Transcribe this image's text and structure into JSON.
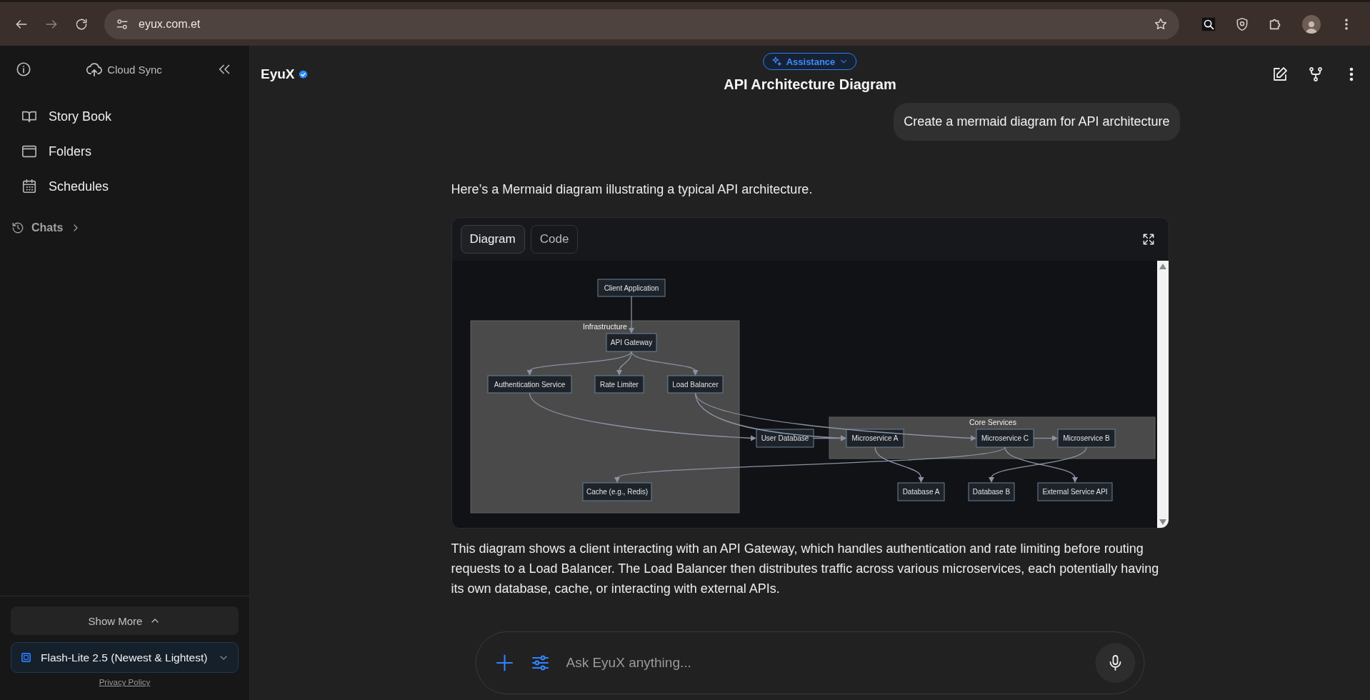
{
  "browser": {
    "url": "eyux.com.et"
  },
  "sidebar": {
    "cloud_sync": "Cloud Sync",
    "items": [
      {
        "label": "Story Book"
      },
      {
        "label": "Folders"
      },
      {
        "label": "Schedules"
      }
    ],
    "chats": "Chats",
    "show_more": "Show More",
    "model": "Flash-Lite 2.5 (Newest & Lightest)",
    "privacy": "Privacy Policy"
  },
  "header": {
    "brand": "EyuX",
    "mode": "Assistance",
    "title": "API Architecture Diagram"
  },
  "chat": {
    "user_message": "Create a mermaid diagram for API architecture",
    "intro": "Here’s a Mermaid diagram illustrating a typical API architecture.",
    "diagram_card": {
      "tabs": [
        {
          "label": "Diagram",
          "selected": true
        },
        {
          "label": "Code",
          "selected": false
        }
      ],
      "clusters": [
        {
          "label": "Infrastructure"
        },
        {
          "label": "Core Services"
        }
      ],
      "nodes": [
        {
          "label": "Client Application"
        },
        {
          "label": "API Gateway"
        },
        {
          "label": "Authentication Service"
        },
        {
          "label": "Rate Limiter"
        },
        {
          "label": "Load Balancer"
        },
        {
          "label": "User Database"
        },
        {
          "label": "Microservice A"
        },
        {
          "label": "Microservice C"
        },
        {
          "label": "Microservice B"
        },
        {
          "label": "Cache (e.g., Redis)"
        },
        {
          "label": "Database A"
        },
        {
          "label": "Database B"
        },
        {
          "label": "External Service API"
        }
      ]
    },
    "summary": "This diagram shows a client interacting with an API Gateway, which handles authentication and rate limiting before routing requests to a Load Balancer. The Load Balancer then distributes traffic across various microservices, each potentially having its own database, cache, or interacting with external APIs."
  },
  "composer": {
    "placeholder": "Ask EyuX anything..."
  }
}
